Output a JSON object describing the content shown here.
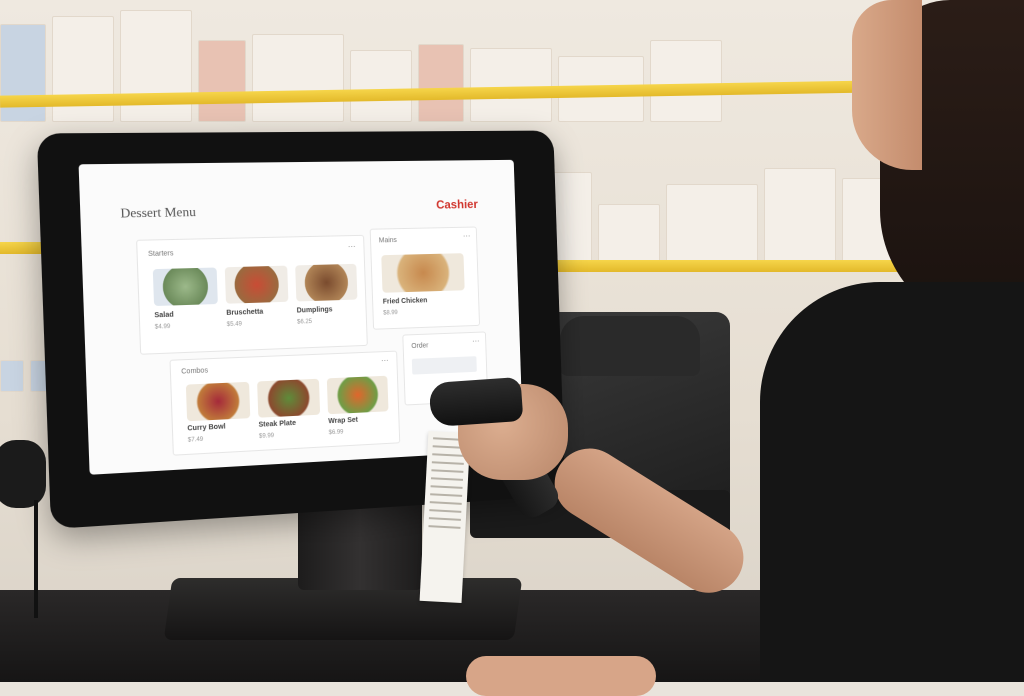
{
  "screen": {
    "title": "Dessert Menu",
    "brand": "Cashier",
    "panels": [
      {
        "label": "Starters",
        "items": [
          {
            "name": "Salad",
            "sub": "$4.99"
          },
          {
            "name": "Bruschetta",
            "sub": "$5.49"
          },
          {
            "name": "Dumplings",
            "sub": "$6.25"
          }
        ]
      },
      {
        "label": "Mains",
        "items": [
          {
            "name": "Fried Chicken",
            "sub": "$8.99"
          }
        ]
      },
      {
        "label": "Combos",
        "items": [
          {
            "name": "Curry Bowl",
            "sub": "$7.49"
          },
          {
            "name": "Steak Plate",
            "sub": "$9.99"
          },
          {
            "name": "Wrap Set",
            "sub": "$6.99"
          }
        ]
      },
      {
        "label": "Order",
        "items": []
      }
    ]
  }
}
